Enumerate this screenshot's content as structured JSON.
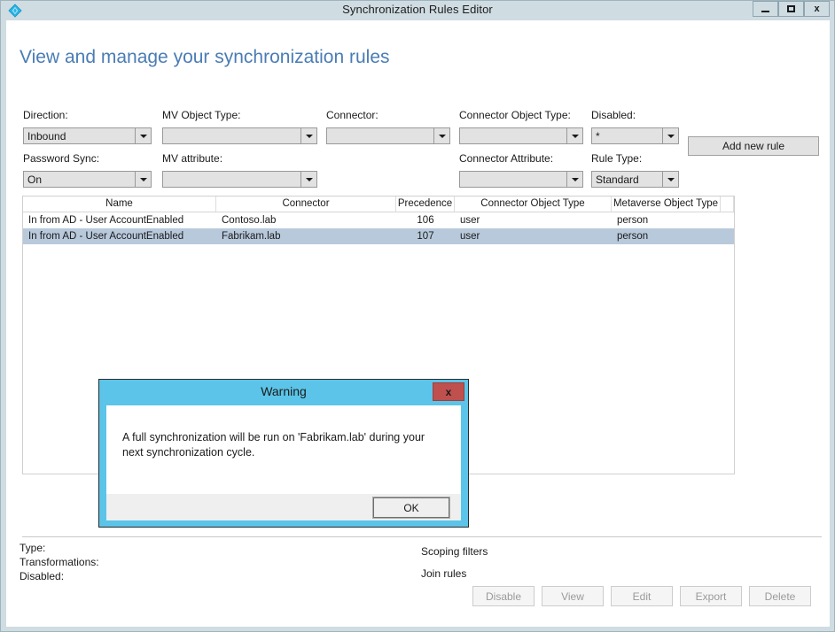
{
  "window": {
    "title": "Synchronization Rules Editor",
    "icon": "sync-diamond-icon",
    "controls": {
      "minimize": "minimize-icon",
      "maximize": "maximize-icon",
      "close": "x"
    }
  },
  "page": {
    "heading": "View and manage your synchronization rules"
  },
  "filters": [
    {
      "label": "Direction:",
      "value": "Inbound",
      "name": "direction",
      "enabled": true
    },
    {
      "label": "MV Object Type:",
      "value": "",
      "name": "mv-object-type",
      "enabled": true
    },
    {
      "label": "Connector:",
      "value": "",
      "name": "connector",
      "enabled": true
    },
    {
      "label": "Connector Object Type:",
      "value": "",
      "name": "connector-object-type",
      "enabled": true
    },
    {
      "label": "Disabled:",
      "value": "*",
      "name": "disabled",
      "enabled": true
    },
    {
      "label": "Password Sync:",
      "value": "On",
      "name": "password-sync",
      "enabled": true
    },
    {
      "label": "MV attribute:",
      "value": "",
      "name": "mv-attribute",
      "enabled": true
    },
    {
      "label": "Connector Attribute:",
      "value": "",
      "name": "connector-attribute",
      "enabled": true
    },
    {
      "label": "Rule Type:",
      "value": "Standard",
      "name": "rule-type",
      "enabled": true
    }
  ],
  "toolbar": {
    "add_new_rule": "Add new rule"
  },
  "grid": {
    "columns": [
      "Name",
      "Connector",
      "Precedence",
      "Connector Object Type",
      "Metaverse Object Type"
    ],
    "rows": [
      {
        "name": "In from AD - User AccountEnabled",
        "connector": "Contoso.lab",
        "precedence": "106",
        "connector_object_type": "user",
        "metaverse_object_type": "person",
        "selected": false
      },
      {
        "name": "In from AD - User AccountEnabled",
        "connector": "Fabrikam.lab",
        "precedence": "107",
        "connector_object_type": "user",
        "metaverse_object_type": "person",
        "selected": true
      }
    ]
  },
  "details": {
    "left": [
      "Type:",
      "Transformations:",
      "Disabled:"
    ],
    "right": [
      "Scoping filters",
      "Join rules"
    ]
  },
  "footer_buttons": [
    {
      "label": "Disable",
      "name": "disable-button"
    },
    {
      "label": "View",
      "name": "view-button"
    },
    {
      "label": "Edit",
      "name": "edit-button"
    },
    {
      "label": "Export",
      "name": "export-button"
    },
    {
      "label": "Delete",
      "name": "delete-button"
    }
  ],
  "dialog": {
    "title": "Warning",
    "close_label": "x",
    "message": "A full synchronization will be run on 'Fabrikam.lab' during your next synchronization cycle.",
    "ok_label": "OK"
  },
  "colors": {
    "titlebar": "#cfdce2",
    "heading": "#4a7cb5",
    "dialog_border": "#5bc4e8",
    "close_button": "#c0504d",
    "row_selected": "#b8c9dc",
    "icon": "#29b6e8"
  }
}
